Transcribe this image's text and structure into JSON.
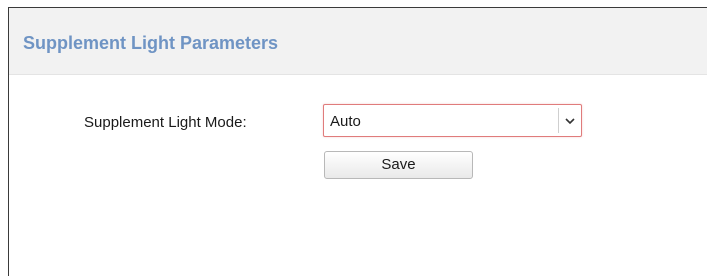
{
  "panel": {
    "title": "Supplement Light Parameters"
  },
  "form": {
    "mode_label": "Supplement Light Mode:",
    "mode_value": "Auto",
    "save_label": "Save"
  },
  "icons": {
    "dropdown": "chevron-down-icon"
  },
  "colors": {
    "title": "#6f94c4",
    "header_background": "#f2f2f2",
    "select_focus_border": "#e07c7c"
  }
}
